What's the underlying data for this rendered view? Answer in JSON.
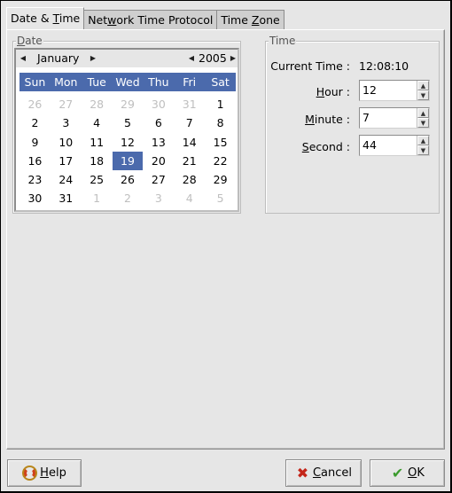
{
  "tabs": [
    {
      "pre": "Date & ",
      "mn": "T",
      "post": "ime",
      "active": true
    },
    {
      "pre": "Net",
      "mn": "w",
      "post": "ork Time Protocol",
      "active": false
    },
    {
      "pre": "Time ",
      "mn": "Z",
      "post": "one",
      "active": false
    }
  ],
  "date_frame": {
    "label_mn": "D",
    "label_rest": "ate",
    "month": "January",
    "year": "2005",
    "weekdays": [
      "Sun",
      "Mon",
      "Tue",
      "Wed",
      "Thu",
      "Fri",
      "Sat"
    ],
    "weeks": [
      [
        {
          "d": "26",
          "o": true
        },
        {
          "d": "27",
          "o": true
        },
        {
          "d": "28",
          "o": true
        },
        {
          "d": "29",
          "o": true
        },
        {
          "d": "30",
          "o": true
        },
        {
          "d": "31",
          "o": true
        },
        {
          "d": "1"
        }
      ],
      [
        {
          "d": "2"
        },
        {
          "d": "3"
        },
        {
          "d": "4"
        },
        {
          "d": "5"
        },
        {
          "d": "6"
        },
        {
          "d": "7"
        },
        {
          "d": "8"
        }
      ],
      [
        {
          "d": "9"
        },
        {
          "d": "10"
        },
        {
          "d": "11"
        },
        {
          "d": "12"
        },
        {
          "d": "13"
        },
        {
          "d": "14"
        },
        {
          "d": "15"
        }
      ],
      [
        {
          "d": "16"
        },
        {
          "d": "17"
        },
        {
          "d": "18"
        },
        {
          "d": "19",
          "sel": true
        },
        {
          "d": "20"
        },
        {
          "d": "21"
        },
        {
          "d": "22"
        }
      ],
      [
        {
          "d": "23"
        },
        {
          "d": "24"
        },
        {
          "d": "25"
        },
        {
          "d": "26"
        },
        {
          "d": "27"
        },
        {
          "d": "28"
        },
        {
          "d": "29"
        }
      ],
      [
        {
          "d": "30"
        },
        {
          "d": "31"
        },
        {
          "d": "1",
          "o": true
        },
        {
          "d": "2",
          "o": true
        },
        {
          "d": "3",
          "o": true
        },
        {
          "d": "4",
          "o": true
        },
        {
          "d": "5",
          "o": true
        }
      ]
    ],
    "selected_day": "19"
  },
  "time_frame": {
    "label": "Time",
    "current_label": "Current Time :",
    "current_value": "12:08:10",
    "hour": {
      "mn": "H",
      "rest": "our :",
      "value": "12"
    },
    "minute": {
      "mn": "M",
      "rest": "inute :",
      "value": "7"
    },
    "second": {
      "mn": "S",
      "rest": "econd :",
      "value": "44"
    }
  },
  "buttons": {
    "help": {
      "mn": "H",
      "rest": "elp",
      "icon": "lifebuoy-icon"
    },
    "cancel": {
      "mn": "C",
      "rest": "ancel",
      "icon": "x-icon"
    },
    "ok": {
      "mn": "O",
      "rest": "K",
      "icon": "check-icon"
    }
  },
  "colors": {
    "selection": "#4b6aac",
    "window_bg": "#e6e6e6"
  }
}
